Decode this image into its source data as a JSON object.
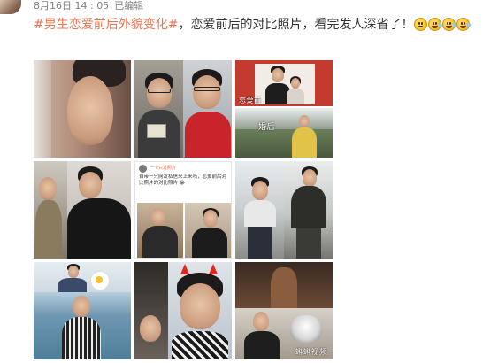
{
  "post": {
    "timestamp": "8月16日 14 : 05",
    "edited_label": "已编辑",
    "hashtag": "#男生恋爱前后外貌变化#",
    "text": "，恋爱前后的对比照片，看完发人深省了！",
    "emojis": [
      "thinking-emoji",
      "laugh-cry-emoji",
      "laugh-cry-emoji",
      "laugh-cry-emoji"
    ]
  },
  "photos": {
    "p3_caption_before": "恋爱前",
    "p3_caption_after": "婚后",
    "p5_screenshot_name": "一个只发照片",
    "p5_screenshot_text": "自带一只网友私信来上来吗，恋爱前后对比照片的对比照片 😂",
    "p9_watermark": "蝌蝌视频"
  },
  "colors": {
    "hashtag": "#eb7350",
    "text": "#333333",
    "meta": "#808080"
  }
}
